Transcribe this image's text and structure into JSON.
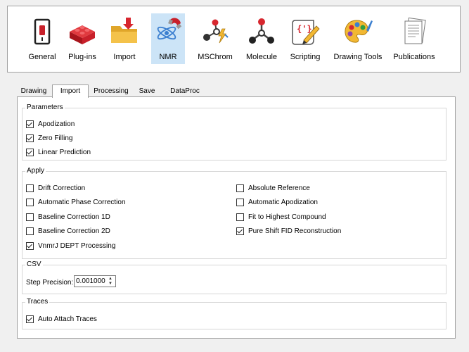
{
  "toolbar": {
    "items": [
      {
        "label": "General",
        "icon": "switch-icon"
      },
      {
        "label": "Plug-ins",
        "icon": "bricks-icon"
      },
      {
        "label": "Import",
        "icon": "folder-import-icon"
      },
      {
        "label": "NMR",
        "icon": "nmr-magnet-icon",
        "selected": true
      },
      {
        "label": "MSChrom",
        "icon": "mschrom-icon"
      },
      {
        "label": "Molecule",
        "icon": "molecule-icon"
      },
      {
        "label": "Scripting",
        "icon": "script-icon"
      },
      {
        "label": "Drawing Tools",
        "icon": "palette-icon"
      },
      {
        "label": "Publications",
        "icon": "publications-icon"
      }
    ]
  },
  "tabs": [
    "Drawing",
    "Import",
    "Processing",
    "Save",
    "DataProc"
  ],
  "active_tab": "Import",
  "parameters": {
    "title": "Parameters",
    "items": [
      {
        "label": "Apodization",
        "checked": true
      },
      {
        "label": "Zero Filling",
        "checked": true
      },
      {
        "label": "Linear Prediction",
        "checked": true
      }
    ]
  },
  "apply": {
    "title": "Apply",
    "left": [
      {
        "label": "Drift Correction",
        "checked": false
      },
      {
        "label": "Automatic Phase Correction",
        "checked": false
      },
      {
        "label": "Baseline Correction 1D",
        "checked": false
      },
      {
        "label": "Baseline Correction 2D",
        "checked": false
      },
      {
        "label": "VnmrJ DEPT Processing",
        "checked": true
      }
    ],
    "right": [
      {
        "label": "Absolute Reference",
        "checked": false
      },
      {
        "label": "Automatic Apodization",
        "checked": false
      },
      {
        "label": "Fit to Highest Compound",
        "checked": false
      },
      {
        "label": "Pure Shift FID Reconstruction",
        "checked": true
      }
    ]
  },
  "csv": {
    "title": "CSV",
    "step_label": "Step Precision:",
    "step_value": "0.001000"
  },
  "traces": {
    "title": "Traces",
    "items": [
      {
        "label": "Auto Attach Traces",
        "checked": true
      }
    ]
  },
  "colors": {
    "selection": "#cce4f7",
    "red": "#c8202a",
    "folder": "#f2b833",
    "blue": "#3b7fd0"
  }
}
